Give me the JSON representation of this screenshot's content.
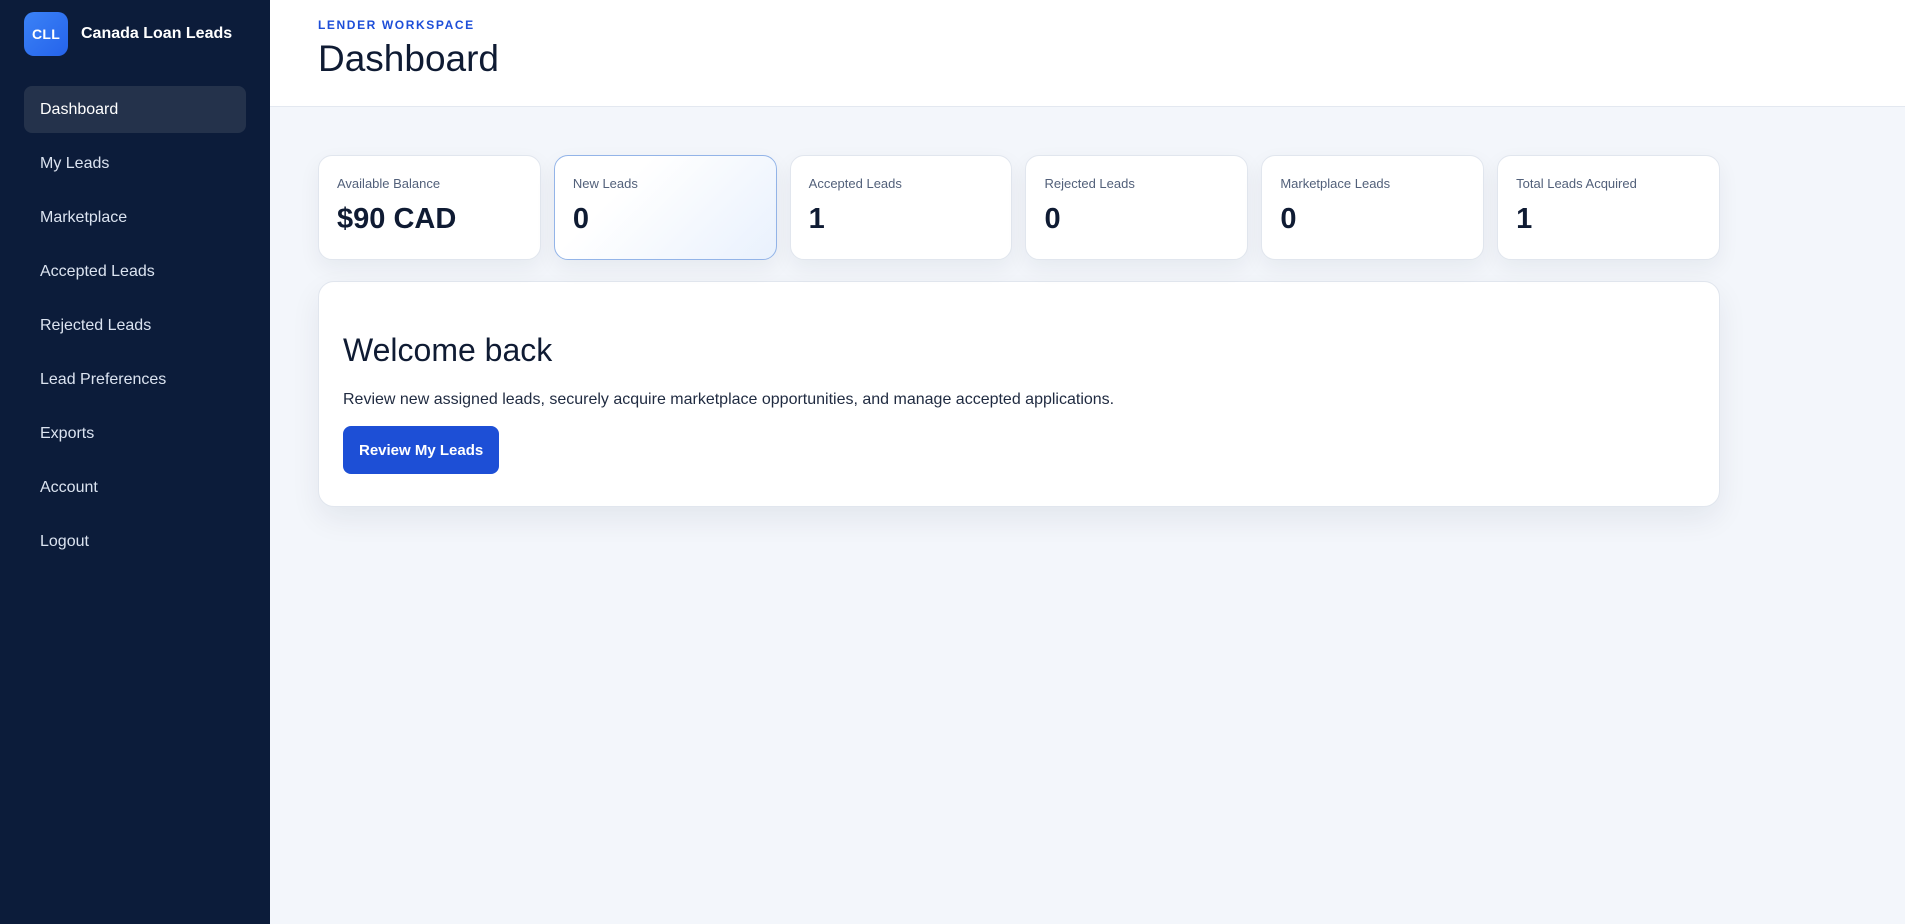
{
  "brand": {
    "logo_text": "CLL",
    "name": "Canada Loan Leads"
  },
  "sidebar": {
    "items": [
      {
        "label": "Dashboard",
        "active": true
      },
      {
        "label": "My Leads"
      },
      {
        "label": "Marketplace"
      },
      {
        "label": "Accepted Leads"
      },
      {
        "label": "Rejected Leads"
      },
      {
        "label": "Lead Preferences"
      },
      {
        "label": "Exports"
      },
      {
        "label": "Account"
      },
      {
        "label": "Logout"
      }
    ]
  },
  "header": {
    "eyebrow": "LENDER WORKSPACE",
    "title": "Dashboard"
  },
  "stats": [
    {
      "label": "Available Balance",
      "value": "$90 CAD"
    },
    {
      "label": "New Leads",
      "value": "0"
    },
    {
      "label": "Accepted Leads",
      "value": "1"
    },
    {
      "label": "Rejected Leads",
      "value": "0"
    },
    {
      "label": "Marketplace Leads",
      "value": "0"
    },
    {
      "label": "Total Leads Acquired",
      "value": "1"
    }
  ],
  "welcome": {
    "title": "Welcome back",
    "text": "Review new assigned leads, securely acquire marketplace opportunities, and manage accepted applications.",
    "button_label": "Review My Leads"
  },
  "colors": {
    "sidebar_bg": "#0c1c3a",
    "accent": "#1d4fd6",
    "page_bg": "#f3f6fb"
  }
}
